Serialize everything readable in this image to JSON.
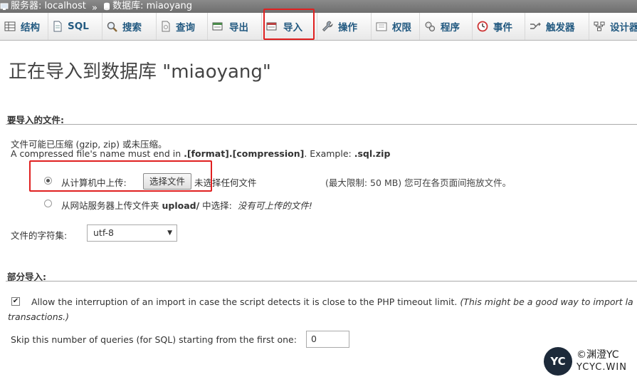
{
  "breadcrumb": {
    "server": "服务器: localhost",
    "separator": "»",
    "database": "数据库: miaoyang"
  },
  "tabs": [
    {
      "label": "结构",
      "icon": "structure-icon"
    },
    {
      "label": "SQL",
      "icon": "sql-icon"
    },
    {
      "label": "搜索",
      "icon": "search-icon"
    },
    {
      "label": "查询",
      "icon": "query-icon"
    },
    {
      "label": "导出",
      "icon": "export-icon"
    },
    {
      "label": "导入",
      "icon": "import-icon"
    },
    {
      "label": "操作",
      "icon": "wrench-icon"
    },
    {
      "label": "权限",
      "icon": "privileges-icon"
    },
    {
      "label": "程序",
      "icon": "routines-icon"
    },
    {
      "label": "事件",
      "icon": "events-clock-icon"
    },
    {
      "label": "触发器",
      "icon": "triggers-icon"
    },
    {
      "label": "设计器",
      "icon": "designer-icon"
    }
  ],
  "title": "正在导入到数据库 \"miaoyang\"",
  "file_section": {
    "heading": "要导入的文件:",
    "note_line1": "文件可能已压缩 (gzip, zip) 或未压缩。",
    "note_line2_prefix": "A compressed file's name must end in ",
    "note_line2_format": ".[format].[compression]",
    "note_line2_example": ". Example: ",
    "note_line2_example_value": ".sql.zip",
    "upload_local_label": "从计算机中上传:",
    "choose_file_button": "选择文件",
    "no_file_chosen": "未选择任何文件",
    "max_size_note": "(最大限制: 50 MB) 您可在各页面间拖放文件。",
    "upload_server_label_prefix": "从网站服务器上传文件夹",
    "upload_server_folder": "upload/",
    "upload_server_label_suffix": "中选择:",
    "no_files_available": "没有可上传的文件!",
    "charset_label": "文件的字符集:",
    "charset_value": "utf-8"
  },
  "partial_section": {
    "heading": "部分导入:",
    "allow_interrupt_label": "Allow the interruption of an import in case the script detects it is close to the PHP timeout limit.",
    "allow_interrupt_note_1": "(This might be a good way to import la",
    "allow_interrupt_note_2": "transactions.)",
    "allow_interrupt_checked": true,
    "skip_label": "Skip this number of queries (for SQL) starting from the first one:",
    "skip_value": "0"
  },
  "watermark": {
    "badge": "YC",
    "line1": "©渊澄YC",
    "line2": "YCYC.WIN"
  },
  "colors": {
    "tab_text": "#235a81",
    "highlight": "#e02020",
    "breadcrumb_bg": "#7a7a7a"
  }
}
